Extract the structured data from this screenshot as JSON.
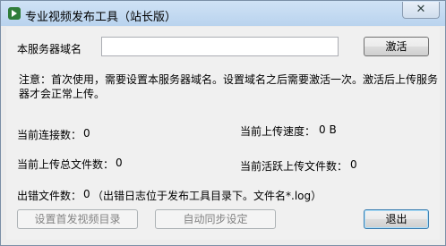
{
  "window": {
    "title": "专业视频发布工具（站长版）",
    "close_glyph": "✕"
  },
  "server": {
    "domain_label": "本服务器域名",
    "domain_value": "",
    "activate_label": "激活"
  },
  "notice": "注意：首次使用，需要设置本服务器域名。设置域名之后需要激活一次。激活后上传服务器才会正常上传。",
  "stats": {
    "connections_label": "当前连接数：",
    "connections_value": "0",
    "upload_speed_label": "当前上传速度：",
    "upload_speed_value": "0 B",
    "total_uploads_label": "当前上传总文件数：",
    "total_uploads_value": "0",
    "active_uploads_label": "当前活跃上传文件数：",
    "active_uploads_value": "0",
    "errors_label": "出错文件数：",
    "errors_value": "0",
    "errors_note": "（出错日志位于发布工具目录下。文件名*.log）"
  },
  "buttons": {
    "set_dir": "设置首发视频目录",
    "auto_sync": "自动同步设定",
    "exit": "退出"
  }
}
